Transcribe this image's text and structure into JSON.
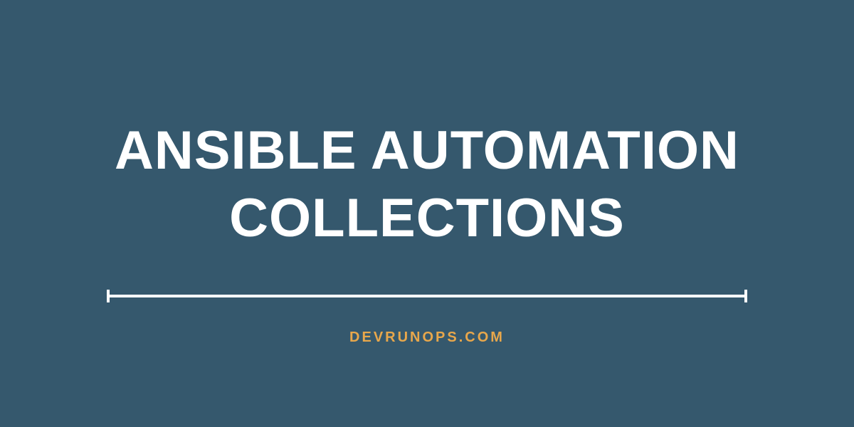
{
  "title_line1": "ANSIBLE AUTOMATION",
  "title_line2": "COLLECTIONS",
  "subtitle": "DEVRUNOPS.COM",
  "colors": {
    "background": "#35586d",
    "title": "#ffffff",
    "divider": "#ffffff",
    "subtitle": "#e8a74b"
  }
}
